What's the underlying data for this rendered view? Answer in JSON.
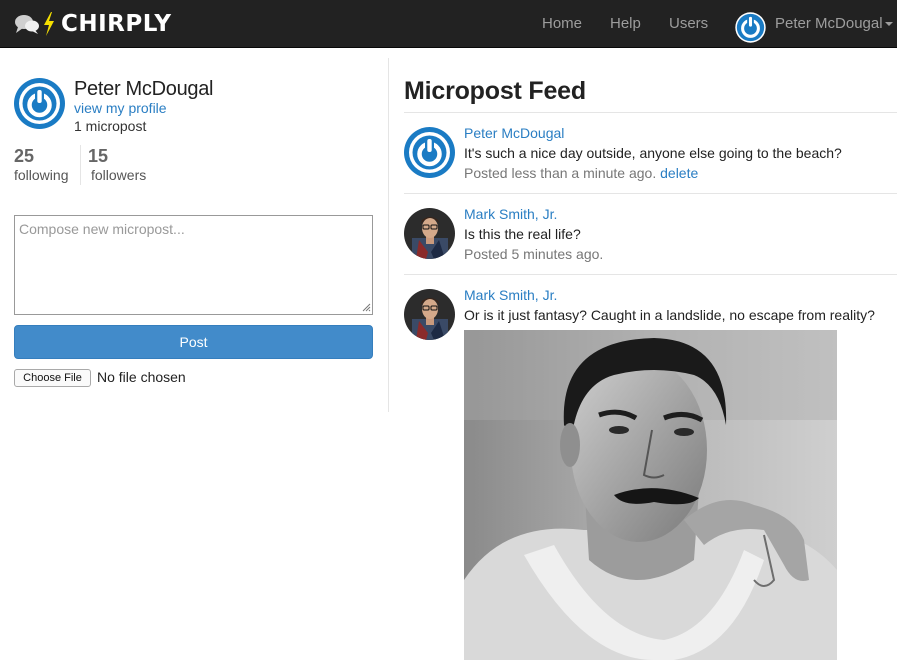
{
  "navbar": {
    "brand": "CHIRPLY",
    "links": [
      "Home",
      "Help",
      "Users"
    ],
    "user_name": "Peter McDougal"
  },
  "sidebar": {
    "name": "Peter McDougal",
    "profile_link": "view my profile",
    "micropost_count": "1 micropost",
    "stats": [
      {
        "value": "25",
        "label": "following"
      },
      {
        "value": "15",
        "label": "followers"
      }
    ],
    "compose_placeholder": "Compose new micropost...",
    "post_button": "Post",
    "file_button": "Choose File",
    "file_status": "No file chosen"
  },
  "feed": {
    "title": "Micropost Feed",
    "posts": [
      {
        "user": "Peter McDougal",
        "text": "It's such a nice day outside, anyone else going to the beach?",
        "time": "Posted less than a minute ago.",
        "action": "delete",
        "avatar": "power-logo"
      },
      {
        "user": "Mark Smith, Jr.",
        "text": "Is this the real life?",
        "time": "Posted 5 minutes ago.",
        "avatar": "photo"
      },
      {
        "user": "Mark Smith, Jr.",
        "text": "Or is it just fantasy? Caught in a landslide, no escape from reality?",
        "avatar": "photo",
        "image": "black-and-white portrait photo"
      }
    ]
  },
  "colors": {
    "navbar_bg": "#222222",
    "link": "#2a7ec3",
    "button": "#428bca",
    "brand_bolt": "#f5e000"
  }
}
